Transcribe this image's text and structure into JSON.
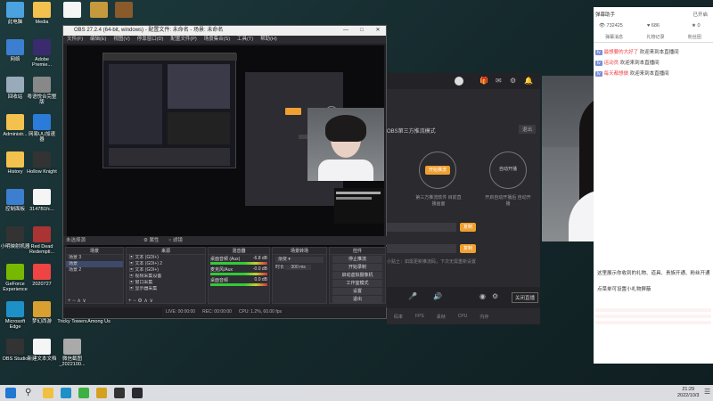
{
  "desktop_icons": [
    {
      "label": "此电脑",
      "color": "#4aa3df"
    },
    {
      "label": "Media",
      "color": "#f2c14e"
    },
    {
      "label": "",
      "color": "#f5f5f5"
    },
    {
      "label": "",
      "color": "#c49a3c"
    },
    {
      "label": "",
      "color": "#8b5a2b"
    },
    {
      "label": "网络",
      "color": "#3c7ecf"
    },
    {
      "label": "Adobe Premie...",
      "color": "#3a2a6e"
    },
    {
      "label": "回收站",
      "color": "#9ab"
    },
    {
      "label": "粤语悦合完整 版",
      "color": "#888"
    },
    {
      "label": "Administr...",
      "color": "#f2c14e"
    },
    {
      "label": "网易UU加速 器",
      "color": "#2b7bd9"
    },
    {
      "label": "History",
      "color": "#f2c14e"
    },
    {
      "label": "Hollow Knight",
      "color": "#333"
    },
    {
      "label": "控制面板",
      "color": "#3c7ecf"
    },
    {
      "label": "3147B1fc...",
      "color": "#f5f5f5"
    },
    {
      "label": "小明映射机器",
      "color": "#333"
    },
    {
      "label": "Red Dead Redempti...",
      "color": "#a33"
    },
    {
      "label": "GeForce Experience",
      "color": "#76b900"
    },
    {
      "label": "2020727",
      "color": "#e44"
    },
    {
      "label": "Microsoft Edge",
      "color": "#1e90c8"
    },
    {
      "label": "梦幻西游",
      "color": "#d8a030"
    },
    {
      "label": "Tricky Towers",
      "color": "#c8a060"
    },
    {
      "label": "Among Us",
      "color": "#c33"
    },
    {
      "label": "OBS Studio",
      "color": "#333"
    },
    {
      "label": "新建文本文档",
      "color": "#f5f5f5"
    },
    {
      "label": "微信截图 _2022100...",
      "color": "#aaa"
    }
  ],
  "obs": {
    "title": "OBS 27.2.4 (64-bit, windows) - 配置文件: 未命名 - 场景: 未命名",
    "menu": [
      "文件(F)",
      "编辑(E)",
      "视图(V)",
      "停靠窗口(D)",
      "配置文件(P)",
      "场景集合(S)",
      "工具(T)",
      "帮助(H)"
    ],
    "source_selected": "未选择源",
    "props_label": "属性",
    "filters_label": "滤镜",
    "scenes_header": "场景",
    "scenes": [
      "场景 3",
      "场景",
      "场景 2"
    ],
    "sources_header": "来源",
    "sources": [
      "文本 (GDI+)",
      "文本 (GDI+) 2",
      "文本 (GDI+)",
      "视频采集设备",
      "窗口采集",
      "显示器采集"
    ],
    "mixer_header": "混音器",
    "mixer_items": [
      {
        "name": "桌面音频 (Aux)",
        "db": "-6.8 dB"
      },
      {
        "name": "麦克风/Aux",
        "db": "-0.0 dB"
      },
      {
        "name": "桌面音频",
        "db": "0.0 dB"
      }
    ],
    "transitions_header": "场景转场",
    "transition_value": "渐变",
    "duration_label": "时长",
    "duration_value": "300 ms",
    "controls_header": "控件",
    "controls": [
      "停止推流",
      "开始录制",
      "启动虚拟摄像机",
      "工作室模式",
      "设置",
      "退出"
    ],
    "status": {
      "live": "LIVE: 00:00:00",
      "rec": "REC: 00:00:00",
      "cpu": "CPU: 1.2%, 60.00 fps"
    }
  },
  "helper": {
    "mode_label": "OBS第三方推流模式",
    "exit_label": "退出",
    "option_1": "开始推流",
    "option_1_desc": "第三方推流软件 目前直播画面",
    "option_2": "自动开播",
    "option_2_desc": "开启自动开播后 自动开播",
    "confirm_1": "复制",
    "confirm_2": "复制",
    "hint": "小贴士：如需更新推流码，下次无需重新设置",
    "bottom_btn": "关闭直播",
    "footer_items": [
      "码率",
      "FPS",
      "丢帧",
      "CPU",
      "内存"
    ]
  },
  "chat": {
    "header": {
      "title": "弹幕助手",
      "right": "已开启",
      "viewers": "732425",
      "fans": "686",
      "extra": "0"
    },
    "tabs": [
      "弹幕消息",
      "礼物记录",
      "粉丝团"
    ],
    "messages": [
      {
        "badge": "lv",
        "name": "最想要的大好了",
        "text": "欢迎来到本直播间",
        "color": "#e44"
      },
      {
        "badge": "lv",
        "name": "运动员",
        "text": "欢迎来到本直播间",
        "color": "#e44"
      },
      {
        "badge": "lv",
        "name": "每天都想做",
        "text": "欢迎来到本直播间",
        "color": "#e44"
      }
    ],
    "gift_note": "这里展示你收到的礼物、道具、贵族开通、粉丝开通",
    "gift_note2": "点菜单可设置小礼物屏蔽"
  },
  "taskbar": {
    "time": "21:29",
    "date": "2022/10/3"
  }
}
